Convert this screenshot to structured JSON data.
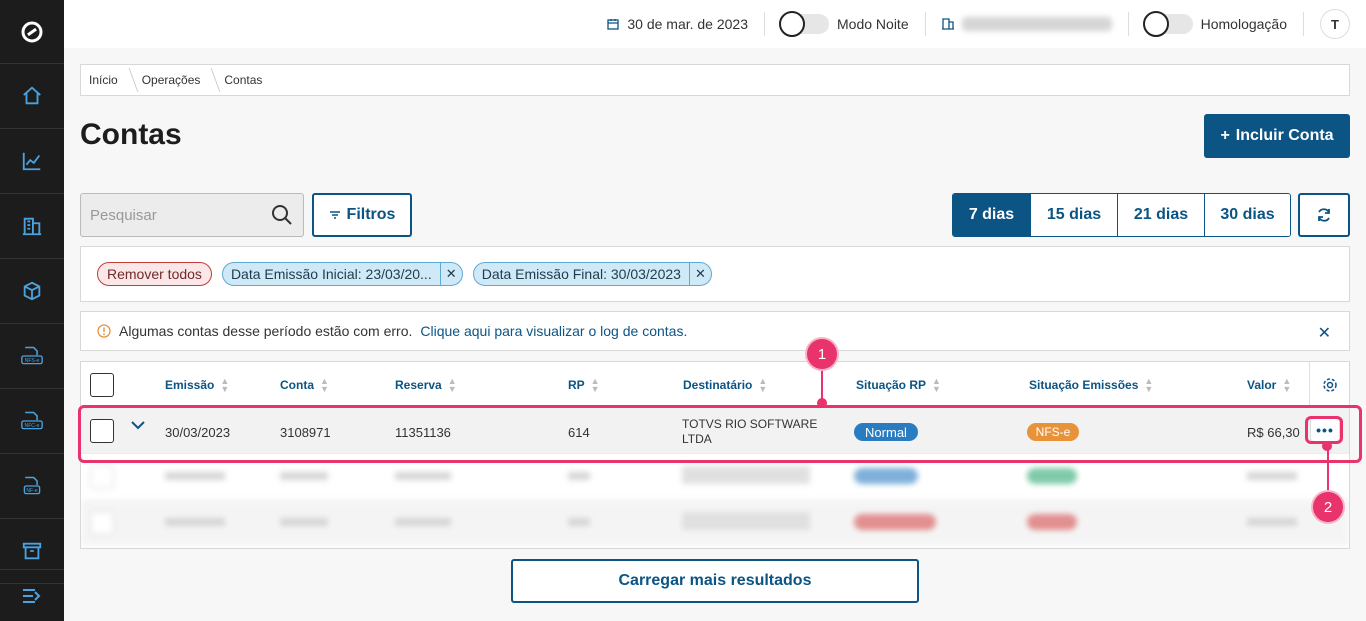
{
  "sidebar": {
    "logo": "totvs-logo",
    "items": [
      {
        "name": "home-icon",
        "label": ""
      },
      {
        "name": "chart-icon",
        "label": ""
      },
      {
        "name": "building-icon",
        "label": ""
      },
      {
        "name": "box-icon",
        "label": ""
      },
      {
        "name": "nfse-icon",
        "label": "NFS-e"
      },
      {
        "name": "nfce-icon",
        "label": "NFC-e"
      },
      {
        "name": "nfe-icon",
        "label": "NF-e"
      },
      {
        "name": "archive-icon",
        "label": ""
      }
    ],
    "collapse_icon": "expand-menu-icon"
  },
  "topbar": {
    "date": "30 de mar. de 2023",
    "night_mode_label": "Modo Noite",
    "homologacao_label": "Homologação",
    "avatar_initial": "T"
  },
  "breadcrumb": [
    "Início",
    "Operações",
    "Contas"
  ],
  "page": {
    "title": "Contas",
    "add_button": "Incluir Conta",
    "add_icon": "+"
  },
  "search": {
    "placeholder": "Pesquisar"
  },
  "filter_button": "Filtros",
  "periods": [
    "7 dias",
    "15 dias",
    "21 dias",
    "30 dias"
  ],
  "active_period": "7 dias",
  "filters": {
    "remove_all": "Remover todos",
    "chips": [
      "Data Emissão Inicial: 23/03/20...",
      "Data Emissão Final: 30/03/2023"
    ]
  },
  "alert": {
    "text": "Algumas contas desse período estão com erro.",
    "link": "Clique aqui para visualizar o log de contas."
  },
  "table": {
    "headers": [
      "Emissão",
      "Conta",
      "Reserva",
      "RP",
      "Destinatário",
      "Situação RP",
      "Situação Emissões",
      "Valor"
    ],
    "rows": [
      {
        "emissao": "30/03/2023",
        "conta": "3108971",
        "reserva": "11351136",
        "rp": "614",
        "destinatario_1": "TOTVS RIO SOFTWARE",
        "destinatario_2": "LTDA",
        "situacao_rp": "Normal",
        "situacao_emissoes": "NFS-e",
        "valor": "R$ 66,30"
      }
    ]
  },
  "load_more": "Carregar mais resultados",
  "annotations": [
    "1",
    "2"
  ],
  "colors": {
    "primary": "#0c5483",
    "sidebar": "#1c1c1c",
    "annotation": "#e8336c",
    "badge_normal": "#2a7cc1",
    "badge_nfse": "#e8923a"
  }
}
